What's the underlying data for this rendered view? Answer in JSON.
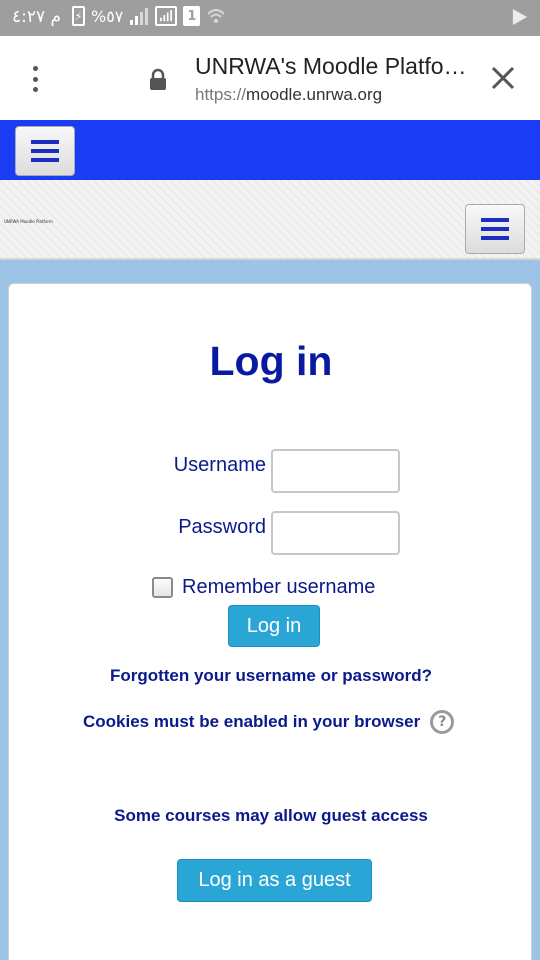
{
  "status_bar": {
    "time": "م ٤:٢٧",
    "battery_pct": "%٥٧",
    "sim_label": "1",
    "icons": [
      "battery-charging-icon",
      "signal-icon",
      "signal-box-icon",
      "sim-1-icon",
      "wifi-icon",
      "play-store-icon"
    ]
  },
  "browser": {
    "page_title": "UNRWA's Moodle Platfo…",
    "url_scheme": "https://",
    "url_host": "moodle.unrwa.org",
    "icons": [
      "more-vert-icon",
      "lock-icon",
      "close-icon"
    ]
  },
  "header": {
    "tiny_banner_text": "UNRWA Moodle Platform",
    "accent_color": "#1a3cf5",
    "icons": [
      "menu-icon",
      "menu-icon"
    ]
  },
  "login": {
    "title": "Log in",
    "username_label": "Username",
    "username_value": "",
    "password_label": "Password",
    "password_value": "",
    "remember_label": "Remember username",
    "remember_checked": false,
    "login_button": "Log in",
    "forgot_link": "Forgotten your username or password?",
    "cookies_notice": "Cookies must be enabled in your browser",
    "help_glyph": "?",
    "guest_notice": "Some courses may allow guest access",
    "guest_button": "Log in as a guest",
    "button_color": "#2aa6d6",
    "text_color": "#0a1a8c"
  }
}
